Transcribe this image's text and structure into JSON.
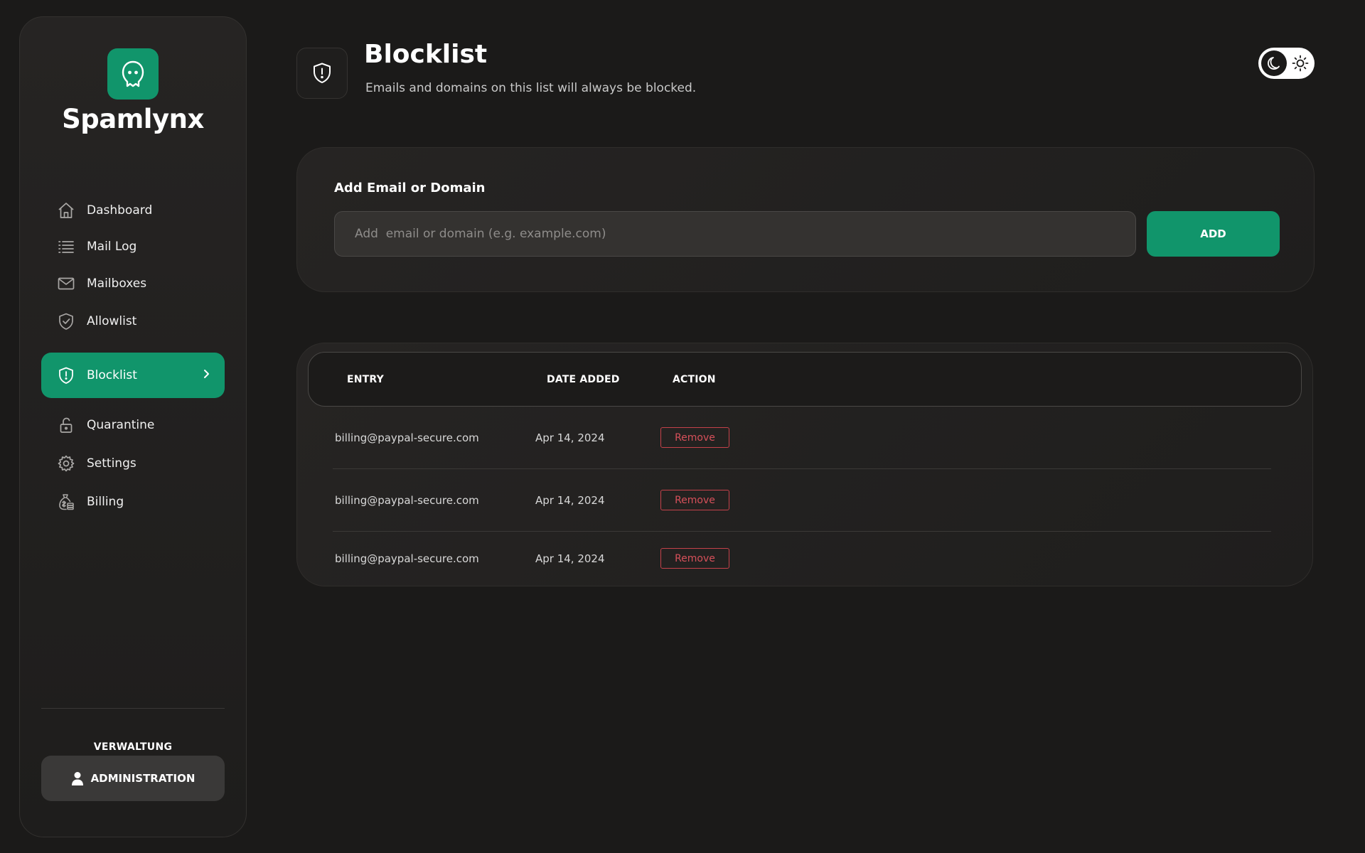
{
  "brand": {
    "name": "Spamlynx",
    "accent": "#11956b"
  },
  "sidebar": {
    "items": [
      {
        "label": "Dashboard",
        "icon": "home-icon"
      },
      {
        "label": "Mail Log",
        "icon": "list-icon"
      },
      {
        "label": "Mailboxes",
        "icon": "envelope-icon"
      },
      {
        "label": "Allowlist",
        "icon": "shield-check-icon"
      },
      {
        "label": "Blocklist",
        "icon": "shield-alert-icon",
        "active": true
      },
      {
        "label": "Quarantine",
        "icon": "unlock-icon"
      },
      {
        "label": "Settings",
        "icon": "gear-icon"
      },
      {
        "label": "Billing",
        "icon": "money-bag-icon"
      }
    ],
    "section_label": "VERWALTUNG",
    "admin_button": "ADMINISTRATION"
  },
  "header": {
    "title": "Blocklist",
    "subtitle": "Emails and domains on this list will always be blocked."
  },
  "add_form": {
    "title": "Add Email or Domain",
    "placeholder": "Add  email or domain (e.g. example.com)",
    "button": "ADD"
  },
  "table": {
    "columns": [
      "ENTRY",
      "DATE ADDED",
      "ACTION"
    ],
    "rows": [
      {
        "entry": "billing@paypal-secure.com",
        "date": "Apr 14, 2024",
        "action": "Remove"
      },
      {
        "entry": "billing@paypal-secure.com",
        "date": "Apr 14, 2024",
        "action": "Remove"
      },
      {
        "entry": "billing@paypal-secure.com",
        "date": "Apr 14, 2024",
        "action": "Remove"
      }
    ]
  },
  "colors": {
    "remove": "#d6505a",
    "background": "#1b1a19"
  }
}
